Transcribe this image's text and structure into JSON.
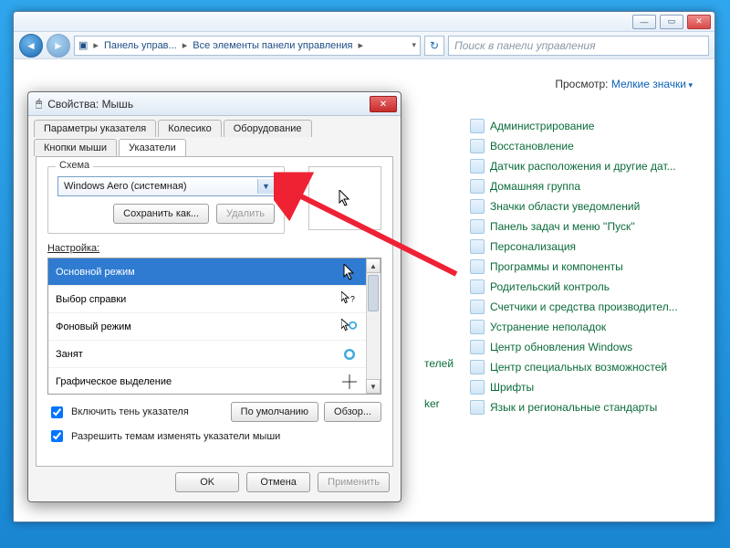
{
  "cp": {
    "breadcrumb": {
      "seg1": "Панель управ...",
      "seg2": "Все элементы панели управления"
    },
    "search_placeholder": "Поиск в панели управления",
    "view_label": "Просмотр:",
    "view_value": "Мелкие значки",
    "items": [
      "Администрирование",
      "Восстановление",
      "Датчик расположения и другие дат...",
      "Домашняя группа",
      "Значки области уведомлений",
      "Панель задач и меню ''Пуск''",
      "Персонализация",
      "Программы и компоненты",
      "Родительский контроль",
      "Счетчики и средства производител...",
      "Устранение неполадок",
      "Центр обновления Windows",
      "Центр специальных возможностей",
      "Шрифты",
      "Язык и региональные стандарты"
    ],
    "hidden_trail": [
      "телей",
      "ker"
    ]
  },
  "dlg": {
    "title": "Свойства: Мышь",
    "tabs_row1": [
      "Параметры указателя",
      "Колесико",
      "Оборудование"
    ],
    "tabs_row2": [
      "Кнопки мыши",
      "Указатели"
    ],
    "active_tab": "Указатели",
    "scheme_legend": "Схема",
    "scheme_value": "Windows Aero (системная)",
    "save_as": "Сохранить как...",
    "delete": "Удалить",
    "list_label": "Настройка:",
    "list": [
      "Основной режим",
      "Выбор справки",
      "Фоновый режим",
      "Занят",
      "Графическое выделение"
    ],
    "check_shadow": "Включить тень указателя",
    "check_theme": "Разрешить темам изменять указатели мыши",
    "defaults": "По умолчанию",
    "browse": "Обзор...",
    "ok": "OK",
    "cancel": "Отмена",
    "apply": "Применить"
  }
}
